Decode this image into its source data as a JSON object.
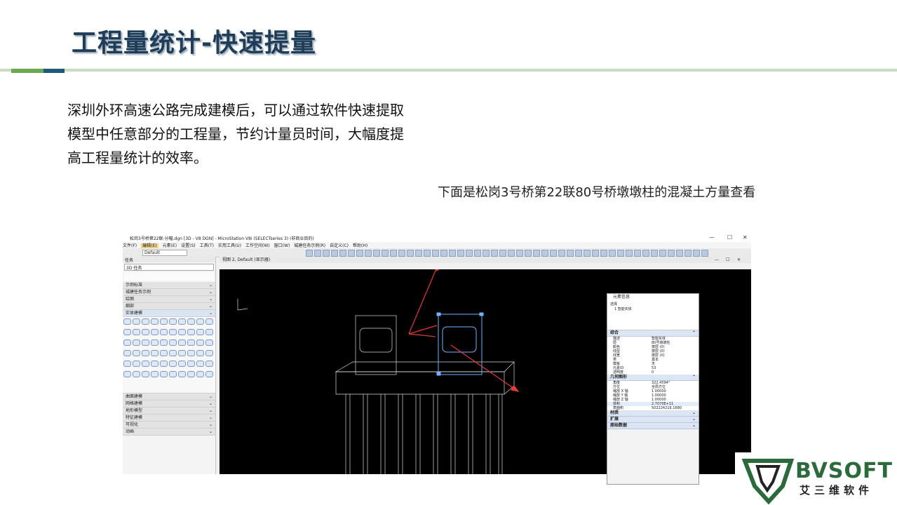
{
  "slide": {
    "title": "工程量统计-快速提量",
    "body": "深圳外环高速公路完成建模后，可以通过软件快速提取模型中任意部分的工程量，节约计量员时间，大幅度提高工程量统计的效率。",
    "caption": "下面是松岗3号桥第22联80号桥墩墩柱的混凝土方量查看"
  },
  "app": {
    "window_title": "松岗3号桥第22联-分幅.dgn [3D - V8 DGN] - MicroStation V8i (SELECTseries 3) (非商业目的)",
    "window_controls": [
      "—",
      "☐",
      "✕"
    ],
    "menu": [
      "文件(F)",
      "编辑(E)",
      "元素(E)",
      "设置(S)",
      "工具(T)",
      "实用工具(U)",
      "工作空间(W)",
      "窗口(W)",
      "城建任务示例(R)",
      "自定义(C)",
      "帮助(H)"
    ],
    "active_menu_index": 1,
    "level_field": "Default"
  },
  "left_panel": {
    "title": "任务",
    "selector": "3D 任务",
    "rows": [
      {
        "label": "示例标准"
      },
      {
        "label": "城建任务示例"
      },
      {
        "label": "绘图"
      },
      {
        "label": "细部"
      },
      {
        "label": "实体建模"
      },
      {
        "label": "曲面建模"
      },
      {
        "label": "网格建模"
      },
      {
        "label": "地形模型"
      },
      {
        "label": "特征建模"
      },
      {
        "label": "可视化"
      },
      {
        "label": "动画"
      }
    ],
    "active_row_index": 4
  },
  "view": {
    "header": "视图 2, Default (显示器)",
    "controls": [
      "—",
      "☐",
      "✕"
    ]
  },
  "properties": {
    "title": "元素信息",
    "tree": [
      "选择",
      "1 智能实体"
    ],
    "sections": [
      {
        "title": "综合",
        "rows": [
          {
            "k": "描述",
            "v": "智能实体"
          },
          {
            "k": "层",
            "v": "80号墩墩柱"
          },
          {
            "k": "颜色",
            "v": "按层 (0)"
          },
          {
            "k": "线型",
            "v": "按层 (0)"
          },
          {
            "k": "线宽",
            "v": "按层 (0)"
          },
          {
            "k": "类",
            "v": "基本"
          },
          {
            "k": "模板",
            "v": "无"
          },
          {
            "k": "元素ID",
            "v": "53"
          },
          {
            "k": "透明度",
            "v": "0"
          }
        ]
      },
      {
        "title": "几何图形",
        "rows": [
          {
            "k": "角度",
            "v": "322.4594°"
          },
          {
            "k": "方位",
            "v": "全局方位"
          },
          {
            "k": "缩放 X 轴",
            "v": "1.00000"
          },
          {
            "k": "缩放 Y 轴",
            "v": "1.00000"
          },
          {
            "k": "缩放 Z 轴",
            "v": "1.00000"
          },
          {
            "k": "体积",
            "v": "2.7070E+11"
          },
          {
            "k": "表面积",
            "v": "502224216.1680"
          }
        ]
      },
      {
        "title": "材质",
        "rows": []
      },
      {
        "title": "扩展",
        "rows": []
      },
      {
        "title": "原始数据",
        "rows": []
      }
    ],
    "highlight_key": "体积"
  },
  "logo": {
    "name": "BVSOFT",
    "tagline": "艾三维软件",
    "colors": {
      "green": "#2b6a3a",
      "dark": "#222222"
    }
  },
  "colors": {
    "title": "#1e3d58",
    "rule": "#c9dcc0",
    "accent_green": "#6aa84f",
    "accent_blue": "#1e5b7a",
    "arrow": "#e53935",
    "wire": "#d9d9d9",
    "selected": "#6fb3ff"
  }
}
